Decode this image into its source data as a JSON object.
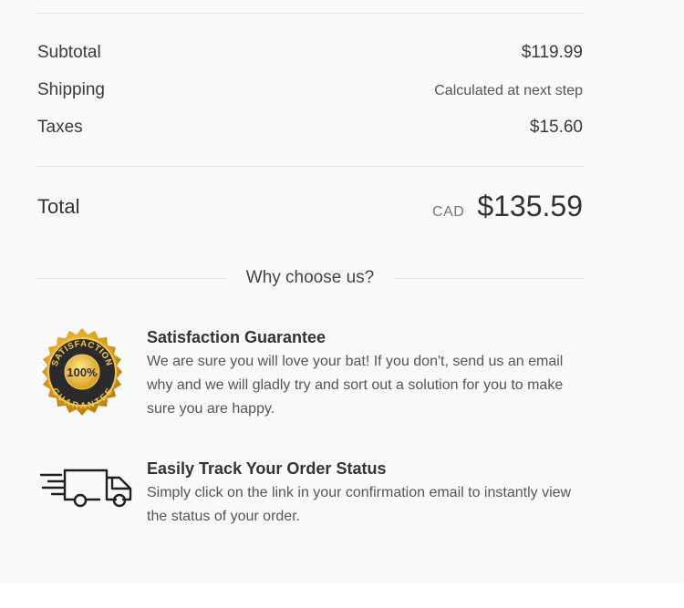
{
  "summary": {
    "subtotal_label": "Subtotal",
    "subtotal_value": "$119.99",
    "shipping_label": "Shipping",
    "shipping_value": "Calculated at next step",
    "taxes_label": "Taxes",
    "taxes_value": "$15.60",
    "total_label": "Total",
    "total_currency": "CAD",
    "total_value": "$135.59"
  },
  "why": {
    "heading": "Why choose us?",
    "features": [
      {
        "icon": "satisfaction-badge-icon",
        "badge_top": "SATISFACTION",
        "badge_center": "100%",
        "badge_bottom": "GUARANTEE",
        "title": "Satisfaction Guarantee",
        "description": "We are sure you will love your bat! If you don't, send us an email why and we will gladly try and sort out a solution for you to make sure you are happy."
      },
      {
        "icon": "delivery-truck-icon",
        "title": "Easily Track Your Order Status",
        "description": "Simply click on the link in your confirmation email to instantly view the status of your order."
      }
    ]
  },
  "colors": {
    "background": "#f9f9f9",
    "divider": "#e1e1e1",
    "text": "#333333",
    "badge_gold": "#e3a81f"
  }
}
